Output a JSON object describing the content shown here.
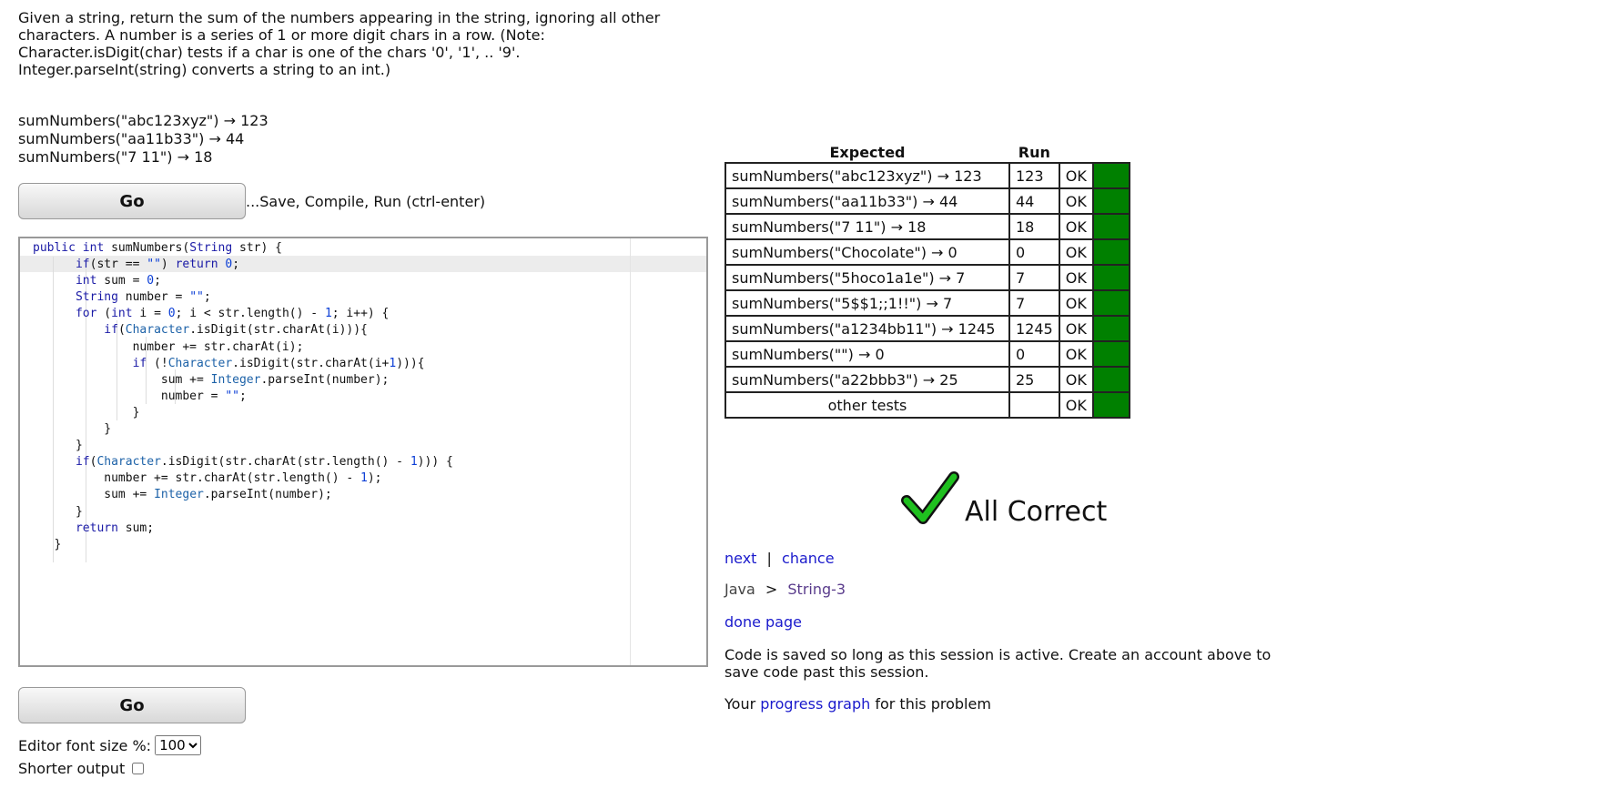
{
  "problem": {
    "description": "Given a string, return the sum of the numbers appearing in the string, ignoring all other characters. A number is a series of 1 or more digit chars in a row. (Note: Character.isDigit(char) tests if a char is one of the chars '0', '1', .. '9'. Integer.parseInt(string) converts a string to an int.)",
    "examples": [
      "sumNumbers(\"abc123xyz\") → 123",
      "sumNumbers(\"aa11b33\") → 44",
      "sumNumbers(\"7 11\") → 18"
    ]
  },
  "go_label": "Go",
  "go_hint": "...Save, Compile, Run (ctrl-enter)",
  "results": {
    "header_expected": "Expected",
    "header_run": "Run",
    "rows": [
      {
        "expected": "sumNumbers(\"abc123xyz\") → 123",
        "run": "123",
        "status": "OK"
      },
      {
        "expected": "sumNumbers(\"aa11b33\") → 44",
        "run": "44",
        "status": "OK"
      },
      {
        "expected": "sumNumbers(\"7 11\") → 18",
        "run": "18",
        "status": "OK"
      },
      {
        "expected": "sumNumbers(\"Chocolate\") → 0",
        "run": "0",
        "status": "OK"
      },
      {
        "expected": "sumNumbers(\"5hoco1a1e\") → 7",
        "run": "7",
        "status": "OK"
      },
      {
        "expected": "sumNumbers(\"5$$1;;1!!\") → 7",
        "run": "7",
        "status": "OK"
      },
      {
        "expected": "sumNumbers(\"a1234bb11\") → 1245",
        "run": "1245",
        "status": "OK"
      },
      {
        "expected": "sumNumbers(\"\") → 0",
        "run": "0",
        "status": "OK"
      },
      {
        "expected": "sumNumbers(\"a22bbb3\") → 25",
        "run": "25",
        "status": "OK"
      },
      {
        "expected": "other tests",
        "run": "",
        "status": "OK"
      }
    ],
    "pass_color": "#008000"
  },
  "all_correct": "All Correct",
  "nav": {
    "next": "next",
    "separator": "|",
    "chance": "chance",
    "crumb_root": "Java",
    "crumb_sep": ">",
    "crumb_section": "String-3",
    "done_page": "done page"
  },
  "saved_note": "Code is saved so long as this session is active. Create an account above to save code past this session.",
  "progress": {
    "prefix": "Your",
    "link": "progress graph",
    "suffix": "for this problem"
  },
  "settings": {
    "font_size_label": "Editor font size %:",
    "font_size_value": "100",
    "shorter_output_label": "Shorter output"
  },
  "code_lines": [
    "public int sumNumbers(String str) {",
    "      if(str == \"\") return 0;",
    "      int sum = 0;",
    "      String number = \"\";",
    "      for (int i = 0; i < str.length() - 1; i++) {",
    "          if(Character.isDigit(str.charAt(i))){",
    "              number += str.charAt(i);",
    "              if (!Character.isDigit(str.charAt(i+1))){",
    "                  sum += Integer.parseInt(number);",
    "                  number = \"\";",
    "              }",
    "          }",
    "      }",
    "      if(Character.isDigit(str.charAt(str.length() - 1))) {",
    "          number += str.charAt(str.length() - 1);",
    "          sum += Integer.parseInt(number);",
    "      }",
    "      return sum;",
    "   }"
  ]
}
